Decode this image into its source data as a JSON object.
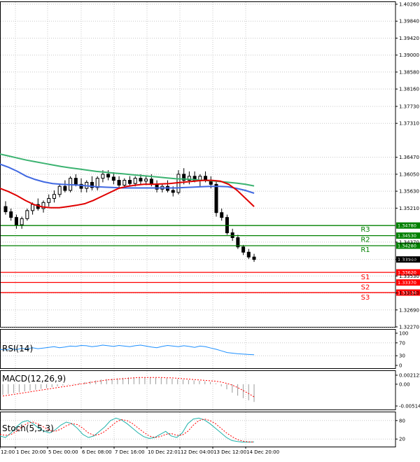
{
  "chart_data": {
    "type": "candlestick",
    "price_axis_ticks": [
      "1.40260",
      "1.39840",
      "1.39420",
      "1.39000",
      "1.38580",
      "1.38160",
      "1.37730",
      "1.37310",
      "1.36470",
      "1.36050",
      "1.35630",
      "1.35210",
      "1.34370",
      "1.33940",
      "1.33530",
      "1.33110",
      "1.32690",
      "1.32270"
    ],
    "current_price": "1.33940",
    "time_labels": [
      "12:00",
      "1 Dec 20:00",
      "5 Dec 00:00",
      "6 Dec 08:00",
      "7 Dec 16:00",
      "10 Dec 22:01",
      "12 Dec 04:00",
      "13 Dec 12:00",
      "14 Dec 20:00"
    ],
    "levels": [
      {
        "name": "R3",
        "value": 1.3478,
        "label": "1.34780",
        "color": "#008000"
      },
      {
        "name": "R2",
        "value": 1.3453,
        "label": "1.34530",
        "color": "#008000"
      },
      {
        "name": "R1",
        "value": 1.3428,
        "label": "1.34280",
        "color": "#008000"
      },
      {
        "name": "S1",
        "value": 1.3362,
        "label": "1.33620",
        "color": "#ff0000"
      },
      {
        "name": "S2",
        "value": 1.3337,
        "label": "1.33370",
        "color": "#ff0000"
      },
      {
        "name": "S3",
        "value": 1.3312,
        "label": "1.33120",
        "color": "#ff0000"
      }
    ],
    "candles": [
      {
        "o": 1.3525,
        "h": 1.3538,
        "l": 1.3505,
        "c": 1.3512
      },
      {
        "o": 1.3512,
        "h": 1.352,
        "l": 1.349,
        "c": 1.3498
      },
      {
        "o": 1.3498,
        "h": 1.3505,
        "l": 1.347,
        "c": 1.348
      },
      {
        "o": 1.348,
        "h": 1.35,
        "l": 1.347,
        "c": 1.3495
      },
      {
        "o": 1.3495,
        "h": 1.352,
        "l": 1.349,
        "c": 1.3515
      },
      {
        "o": 1.3515,
        "h": 1.3535,
        "l": 1.3505,
        "c": 1.353
      },
      {
        "o": 1.353,
        "h": 1.3545,
        "l": 1.3515,
        "c": 1.352
      },
      {
        "o": 1.352,
        "h": 1.354,
        "l": 1.351,
        "c": 1.3535
      },
      {
        "o": 1.3535,
        "h": 1.3555,
        "l": 1.3525,
        "c": 1.3545
      },
      {
        "o": 1.3545,
        "h": 1.3565,
        "l": 1.3535,
        "c": 1.3555
      },
      {
        "o": 1.3555,
        "h": 1.358,
        "l": 1.3548,
        "c": 1.3575
      },
      {
        "o": 1.3575,
        "h": 1.359,
        "l": 1.356,
        "c": 1.3565
      },
      {
        "o": 1.3565,
        "h": 1.36,
        "l": 1.356,
        "c": 1.3595
      },
      {
        "o": 1.3595,
        "h": 1.3605,
        "l": 1.3575,
        "c": 1.358
      },
      {
        "o": 1.358,
        "h": 1.3595,
        "l": 1.356,
        "c": 1.357
      },
      {
        "o": 1.357,
        "h": 1.359,
        "l": 1.356,
        "c": 1.3585
      },
      {
        "o": 1.3585,
        "h": 1.36,
        "l": 1.3565,
        "c": 1.3572
      },
      {
        "o": 1.3572,
        "h": 1.36,
        "l": 1.3565,
        "c": 1.3595
      },
      {
        "o": 1.3595,
        "h": 1.3615,
        "l": 1.3585,
        "c": 1.3605
      },
      {
        "o": 1.3605,
        "h": 1.3615,
        "l": 1.359,
        "c": 1.3598
      },
      {
        "o": 1.3598,
        "h": 1.361,
        "l": 1.358,
        "c": 1.359
      },
      {
        "o": 1.359,
        "h": 1.36,
        "l": 1.357,
        "c": 1.3578
      },
      {
        "o": 1.3578,
        "h": 1.3595,
        "l": 1.357,
        "c": 1.359
      },
      {
        "o": 1.359,
        "h": 1.36,
        "l": 1.3575,
        "c": 1.3582
      },
      {
        "o": 1.3582,
        "h": 1.36,
        "l": 1.3575,
        "c": 1.3595
      },
      {
        "o": 1.3595,
        "h": 1.3605,
        "l": 1.358,
        "c": 1.3588
      },
      {
        "o": 1.3588,
        "h": 1.36,
        "l": 1.3578,
        "c": 1.3593
      },
      {
        "o": 1.3593,
        "h": 1.3605,
        "l": 1.3575,
        "c": 1.358
      },
      {
        "o": 1.358,
        "h": 1.359,
        "l": 1.356,
        "c": 1.3568
      },
      {
        "o": 1.3568,
        "h": 1.358,
        "l": 1.356,
        "c": 1.3575
      },
      {
        "o": 1.3575,
        "h": 1.359,
        "l": 1.356,
        "c": 1.3565
      },
      {
        "o": 1.3565,
        "h": 1.3575,
        "l": 1.355,
        "c": 1.356
      },
      {
        "o": 1.356,
        "h": 1.3615,
        "l": 1.3555,
        "c": 1.3605
      },
      {
        "o": 1.3605,
        "h": 1.362,
        "l": 1.358,
        "c": 1.359
      },
      {
        "o": 1.359,
        "h": 1.3612,
        "l": 1.358,
        "c": 1.36
      },
      {
        "o": 1.36,
        "h": 1.3612,
        "l": 1.3585,
        "c": 1.359
      },
      {
        "o": 1.359,
        "h": 1.3605,
        "l": 1.3575,
        "c": 1.36
      },
      {
        "o": 1.36,
        "h": 1.3612,
        "l": 1.3585,
        "c": 1.359
      },
      {
        "o": 1.359,
        "h": 1.36,
        "l": 1.357,
        "c": 1.358
      },
      {
        "o": 1.358,
        "h": 1.359,
        "l": 1.35,
        "c": 1.351
      },
      {
        "o": 1.351,
        "h": 1.352,
        "l": 1.349,
        "c": 1.3498
      },
      {
        "o": 1.3498,
        "h": 1.3505,
        "l": 1.3455,
        "c": 1.346
      },
      {
        "o": 1.346,
        "h": 1.347,
        "l": 1.344,
        "c": 1.3448
      },
      {
        "o": 1.3448,
        "h": 1.3455,
        "l": 1.342,
        "c": 1.3425
      },
      {
        "o": 1.3425,
        "h": 1.343,
        "l": 1.3405,
        "c": 1.3412
      },
      {
        "o": 1.3412,
        "h": 1.342,
        "l": 1.3395,
        "c": 1.34
      },
      {
        "o": 1.34,
        "h": 1.3408,
        "l": 1.3388,
        "c": 1.3394
      }
    ],
    "ma_green": [
      1.3655,
      1.365,
      1.3645,
      1.364,
      1.3636,
      1.3632,
      1.3628,
      1.3624,
      1.3621,
      1.3618,
      1.3615,
      1.3612,
      1.361,
      1.3608,
      1.3606,
      1.3604,
      1.3602,
      1.36,
      1.3598,
      1.3596,
      1.3594,
      1.3593,
      1.3592,
      1.359,
      1.3589,
      1.3587,
      1.3585,
      1.3583,
      1.358,
      1.3576
    ],
    "ma_blue": [
      1.363,
      1.3622,
      1.3612,
      1.36,
      1.3592,
      1.3586,
      1.3582,
      1.358,
      1.3579,
      1.3578,
      1.3576,
      1.3574,
      1.3573,
      1.3572,
      1.3571,
      1.3571,
      1.3571,
      1.3571,
      1.3571,
      1.3571,
      1.3571,
      1.3572,
      1.3573,
      1.3574,
      1.3575,
      1.3575,
      1.3574,
      1.357,
      1.3565,
      1.3558
    ],
    "ma_red": [
      1.357,
      1.3562,
      1.3552,
      1.354,
      1.353,
      1.3524,
      1.3522,
      1.3522,
      1.3525,
      1.3528,
      1.3532,
      1.354,
      1.355,
      1.356,
      1.357,
      1.3575,
      1.3578,
      1.358,
      1.358,
      1.3581,
      1.3582,
      1.3584,
      1.3586,
      1.3588,
      1.359,
      1.359,
      1.3588,
      1.358,
      1.3565,
      1.3545,
      1.3525
    ],
    "rsi": {
      "title": "RSI(14)",
      "ticks": [
        "100",
        "70",
        "30",
        "0"
      ],
      "values": [
        50,
        48,
        52,
        49,
        53,
        51,
        55,
        52,
        54,
        56,
        58,
        55,
        57,
        60,
        59,
        62,
        61,
        58,
        60,
        63,
        61,
        59,
        62,
        60,
        58,
        61,
        63,
        60,
        57,
        55,
        59,
        62,
        60,
        58,
        61,
        59,
        56,
        60,
        58,
        54,
        50,
        45,
        40,
        38,
        36,
        35,
        34,
        33
      ]
    },
    "macd": {
      "title": "MACD(12,26,9)",
      "ticks": [
        "0.002125",
        "0.00",
        "-0.005144"
      ],
      "histogram": [
        -0.0025,
        -0.0023,
        -0.0021,
        -0.0019,
        -0.0017,
        -0.0015,
        -0.0013,
        -0.0011,
        -0.0009,
        -0.0007,
        -0.0005,
        -0.0003,
        -0.0001,
        0.0001,
        0.0003,
        0.0005,
        0.0007,
        0.0009,
        0.0011,
        0.0012,
        0.0013,
        0.0014,
        0.0015,
        0.0016,
        0.0016,
        0.0016,
        0.0016,
        0.0016,
        0.0015,
        0.0015,
        0.0014,
        0.0013,
        0.0012,
        0.0011,
        0.001,
        0.0009,
        0.0008,
        0.0007,
        0.0005,
        0.0002,
        -0.0005,
        -0.0012,
        -0.002,
        -0.0027,
        -0.0033,
        -0.0038,
        -0.0042
      ],
      "signal": [
        -0.0028,
        -0.0026,
        -0.0024,
        -0.0022,
        -0.002,
        -0.0018,
        -0.0016,
        -0.0014,
        -0.0012,
        -0.001,
        -0.0008,
        -0.0006,
        -0.0004,
        -0.0002,
        0.0,
        0.0002,
        0.0004,
        0.0006,
        0.0008,
        0.001,
        0.0011,
        0.0012,
        0.0013,
        0.0014,
        0.0015,
        0.0016,
        0.0016,
        0.0016,
        0.0016,
        0.0016,
        0.0015,
        0.0015,
        0.0014,
        0.0013,
        0.0012,
        0.0011,
        0.001,
        0.0009,
        0.0008,
        0.0007,
        0.0005,
        0.0002,
        -0.0002,
        -0.0008,
        -0.0015,
        -0.0022,
        -0.003
      ]
    },
    "stoch": {
      "title": "Stoch(5,5,3)",
      "ticks": [
        "80",
        "20"
      ],
      "k": [
        30,
        25,
        40,
        60,
        75,
        80,
        70,
        55,
        45,
        40,
        50,
        65,
        75,
        70,
        55,
        35,
        25,
        30,
        45,
        60,
        80,
        88,
        82,
        70,
        55,
        40,
        28,
        22,
        25,
        35,
        45,
        30,
        25,
        40,
        70,
        85,
        88,
        82,
        70,
        55,
        40,
        25,
        15,
        12,
        10,
        10,
        11
      ],
      "d": [
        35,
        32,
        35,
        45,
        60,
        72,
        75,
        68,
        58,
        48,
        45,
        52,
        63,
        70,
        67,
        55,
        40,
        32,
        35,
        45,
        60,
        75,
        83,
        80,
        70,
        56,
        42,
        30,
        25,
        28,
        35,
        38,
        32,
        33,
        45,
        65,
        80,
        85,
        80,
        70,
        55,
        40,
        28,
        18,
        13,
        11,
        10
      ]
    }
  }
}
